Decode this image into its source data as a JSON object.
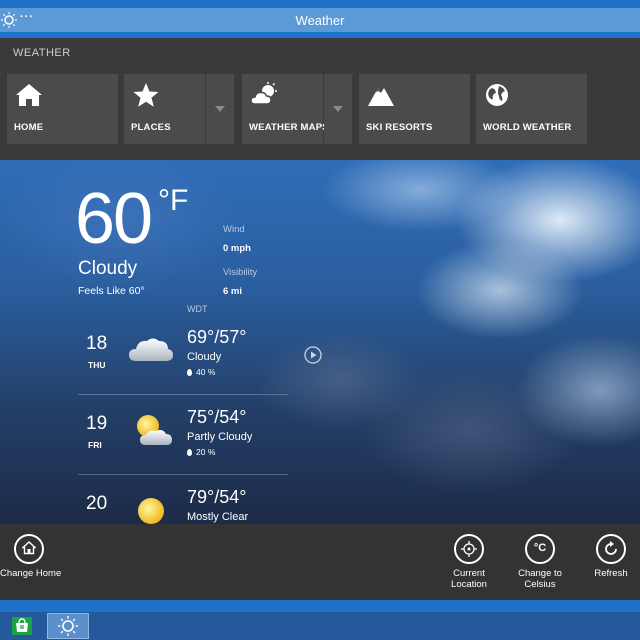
{
  "window": {
    "title": "Weather",
    "menu_dots": "···"
  },
  "nav": {
    "heading": "WEATHER",
    "tiles": [
      {
        "label": "HOME",
        "icon": "home-icon"
      },
      {
        "label": "PLACES",
        "icon": "star-icon"
      },
      {
        "label": "WEATHER MAPS",
        "icon": "cloud-sun-icon"
      },
      {
        "label": "SKI RESORTS",
        "icon": "mountain-icon"
      },
      {
        "label": "WORLD WEATHER",
        "icon": "globe-icon"
      }
    ]
  },
  "current": {
    "temp": "60",
    "unit": "°F",
    "condition": "Cloudy",
    "feels_like": "Feels Like 60°",
    "wind_label": "Wind",
    "wind_value": "0 mph",
    "visibility_label": "Visibility",
    "visibility_value": "6 mi",
    "timezone": "WDT"
  },
  "forecast": [
    {
      "day": "18",
      "dow": "THU",
      "temps": "69°/57°",
      "condition": "Cloudy",
      "precip": "40 %",
      "icon": "cloud-icon"
    },
    {
      "day": "19",
      "dow": "FRI",
      "temps": "75°/54°",
      "condition": "Partly Cloudy",
      "precip": "20 %",
      "icon": "partly-cloudy-icon"
    },
    {
      "day": "20",
      "dow": "",
      "temps": "79°/54°",
      "condition": "Mostly Clear",
      "precip": "",
      "icon": "sun-icon"
    }
  ],
  "appbar": {
    "change_home": "Change Home",
    "current_location_1": "Current",
    "current_location_2": "Location",
    "celsius_1": "Change to",
    "celsius_2": "Celsius",
    "refresh": "Refresh",
    "celsius_glyph": "°C"
  },
  "colors": {
    "titlebar": "#1e73c9",
    "navbar": "#3a3a3a",
    "tile": "#4b4b4b",
    "appbar": "#333333"
  }
}
